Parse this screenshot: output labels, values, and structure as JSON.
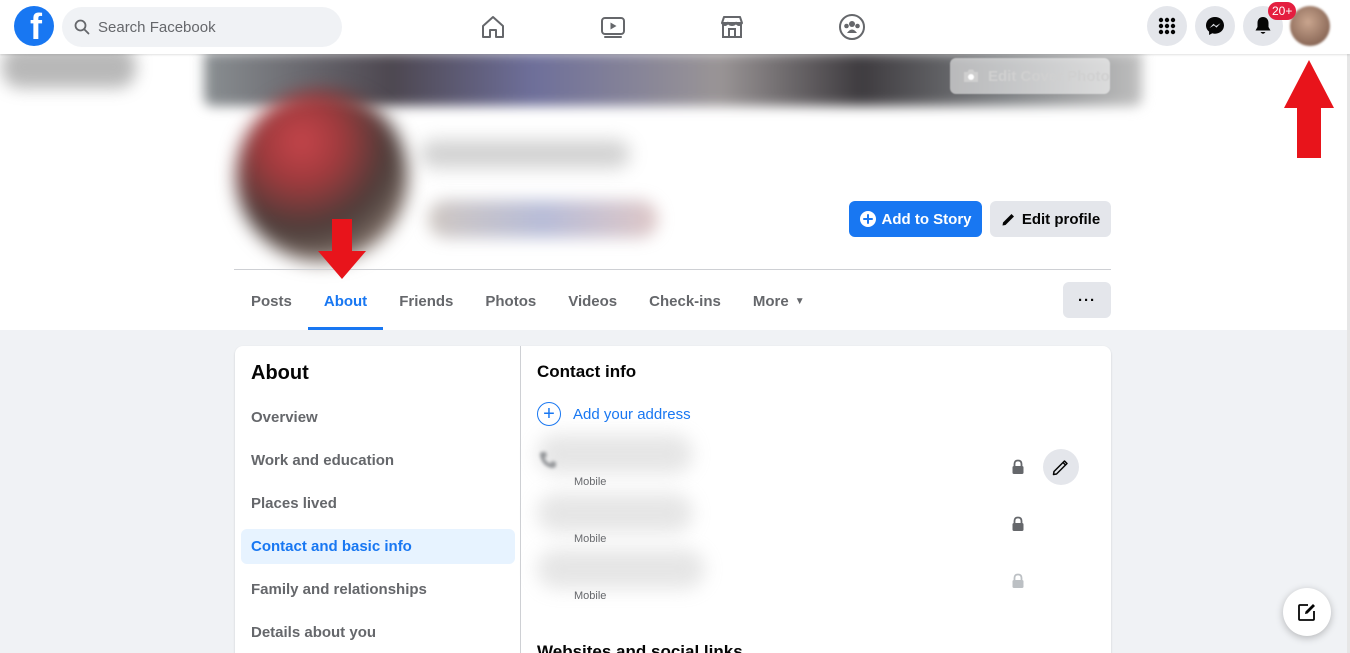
{
  "topbar": {
    "logo_letter": "f",
    "search_placeholder": "Search Facebook",
    "nav": [
      "home-icon",
      "watch-icon",
      "marketplace-icon",
      "groups-icon"
    ],
    "right": [
      "menu-grid-icon",
      "messenger-icon",
      "notifications-icon",
      "account-avatar"
    ],
    "notification_badge": "20+"
  },
  "cover": {
    "edit_cover_label": "Edit Cover Photo"
  },
  "profile": {
    "add_story_label": "Add to Story",
    "edit_profile_label": "Edit profile",
    "tabs": [
      {
        "label": "Posts"
      },
      {
        "label": "About"
      },
      {
        "label": "Friends"
      },
      {
        "label": "Photos"
      },
      {
        "label": "Videos"
      },
      {
        "label": "Check-ins"
      },
      {
        "label": "More"
      }
    ],
    "active_tab": "About",
    "more_dots": "···"
  },
  "about": {
    "title": "About",
    "menu": [
      {
        "label": "Overview"
      },
      {
        "label": "Work and education"
      },
      {
        "label": "Places lived"
      },
      {
        "label": "Contact and basic info"
      },
      {
        "label": "Family and relationships"
      },
      {
        "label": "Details about you"
      }
    ],
    "active_item": "Contact and basic info",
    "contact": {
      "title": "Contact info",
      "add_address": "Add your address",
      "phones": [
        {
          "type": "Mobile"
        },
        {
          "type": "Mobile"
        },
        {
          "type": "Mobile"
        }
      ]
    },
    "websites_title": "Websites and social links"
  },
  "colors": {
    "brand": "#1877f2",
    "annotation_arrow": "#e8141b",
    "badge": "#e41e3f"
  }
}
